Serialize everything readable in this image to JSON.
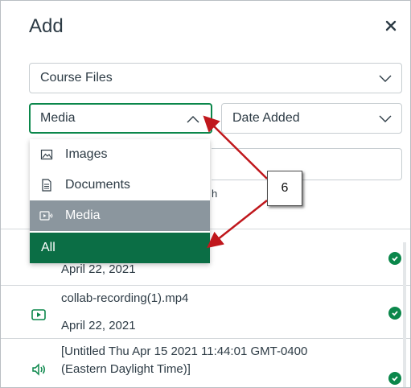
{
  "dialog": {
    "title": "Add",
    "close_glyph": "×"
  },
  "source_select": {
    "value": "Course Files"
  },
  "type_select": {
    "value": "Media"
  },
  "sort_select": {
    "value": "Date Added"
  },
  "search": {
    "partial_text": "h"
  },
  "dropdown": {
    "items": [
      {
        "label": "Images",
        "icon": "image-icon",
        "state": "normal"
      },
      {
        "label": "Documents",
        "icon": "document-icon",
        "state": "normal"
      },
      {
        "label": "Media",
        "icon": "media-icon",
        "state": "selected"
      },
      {
        "label": "All",
        "icon": "",
        "state": "highlighted"
      }
    ]
  },
  "files": [
    {
      "name": "",
      "date": "April 22, 2021",
      "type_icon": "",
      "status": "check-circle-icon"
    },
    {
      "name": "collab-recording(1).mp4",
      "date": "April 22, 2021",
      "type_icon": "video-icon",
      "status": "check-circle-icon"
    },
    {
      "name": "[Untitled Thu Apr 15 2021 11:44:01 GMT-0400",
      "date": "(Eastern Daylight Time)]",
      "type_icon": "audio-icon",
      "status": "check-circle-icon"
    }
  ],
  "annotation": {
    "label": "6"
  },
  "colors": {
    "accent_green": "#0b874b",
    "highlight_green": "#0b6e45",
    "selected_gray": "#8b969e",
    "annotation_arrow": "#c0171c",
    "text": "#2d3b45"
  }
}
